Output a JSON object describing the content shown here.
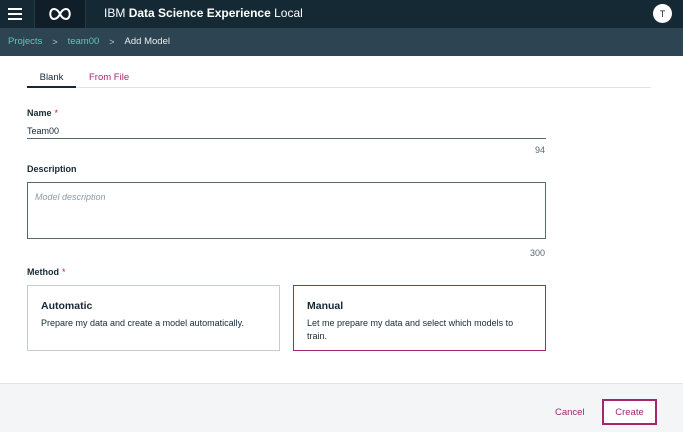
{
  "header": {
    "title_prefix": "IBM",
    "title_bold": "Data Science Experience",
    "title_suffix": "Local",
    "avatar_initial": "T",
    "logo_icon": "infinity-icon"
  },
  "breadcrumb": {
    "items": [
      "Projects",
      "team00"
    ],
    "current": "Add Model",
    "separator": ">"
  },
  "tabs": [
    {
      "label": "Blank",
      "active": true
    },
    {
      "label": "From File",
      "active": false
    }
  ],
  "form": {
    "name_label": "Name",
    "required_mark": "*",
    "name_value": "Team00",
    "name_counter": "94",
    "description_label": "Description",
    "description_placeholder": "Model description",
    "description_counter": "300",
    "method_label": "Method",
    "methods": [
      {
        "title": "Automatic",
        "desc": "Prepare my data and create a model automatically.",
        "selected": false
      },
      {
        "title": "Manual",
        "desc": "Let me prepare my data and select which models to train.",
        "selected": true
      }
    ]
  },
  "footer": {
    "cancel_label": "Cancel",
    "create_label": "Create"
  },
  "colors": {
    "topbar": "#152935",
    "breadbar": "#2d4453",
    "accent": "#a6266e",
    "link": "#5ac8c0"
  }
}
